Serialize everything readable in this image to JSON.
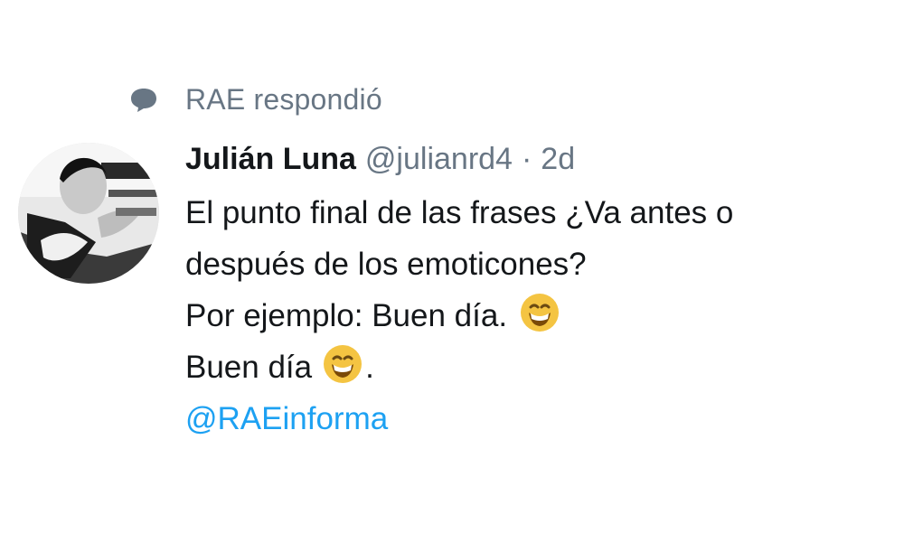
{
  "context": {
    "icon": "reply-bubble-icon",
    "text": "RAE respondió"
  },
  "tweet": {
    "avatar_icon": "user-avatar",
    "author_name": "Julián Luna",
    "author_handle": "@julianrd4",
    "separator": "·",
    "time": "2d",
    "lines": [
      "El punto final de las frases ¿Va antes o",
      "después de los emoticones?",
      "Por ejemplo: Buen día.",
      "Buen día",
      "."
    ],
    "emoji_icon": "grinning-face-emoji",
    "mention": "@RAEinforma",
    "colors": {
      "secondary_text": "#687684",
      "link": "#1da1f2",
      "primary_text": "#14171a"
    }
  }
}
